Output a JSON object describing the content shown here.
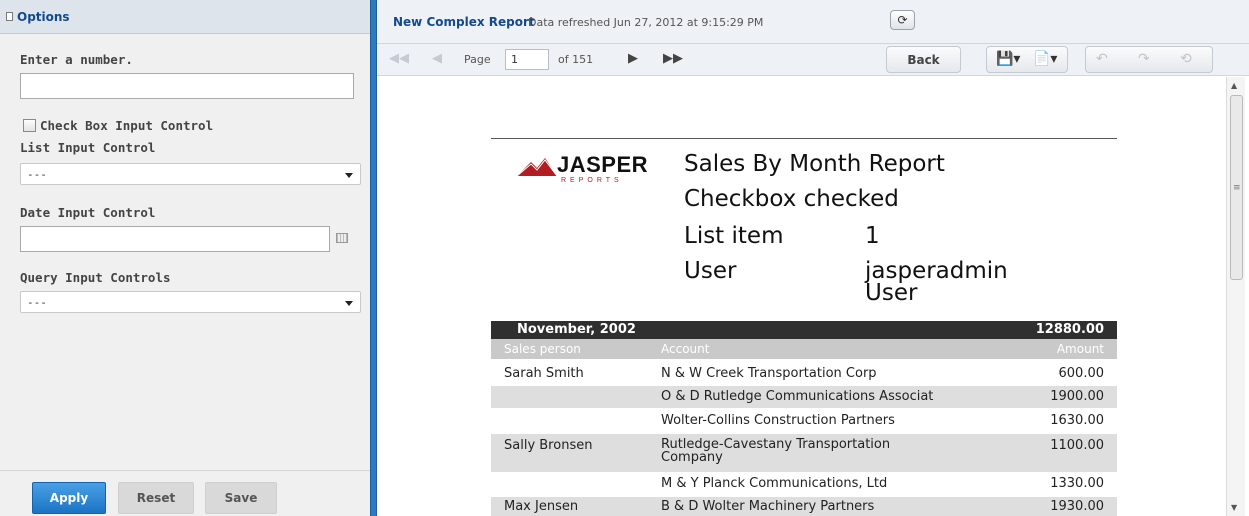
{
  "options": {
    "title": "Options",
    "number_label": "Enter a number.",
    "checkbox_label": "Check Box Input Control",
    "list_label": "List Input Control",
    "list_value": "---",
    "date_label": "Date Input Control",
    "query_label": "Query Input Controls",
    "query_value": "---",
    "apply": "Apply",
    "reset": "Reset",
    "save": "Save"
  },
  "viewer": {
    "report_title": "New Complex Report",
    "refreshed": "Data refreshed Jun 27, 2012 at 9:15:29 PM",
    "page_label": "Page",
    "page_value": "1",
    "of_label": "of 151",
    "back": "Back"
  },
  "report": {
    "logo": "JASPER",
    "logo_sub": "REPORTS",
    "title": "Sales By Month Report",
    "checkbox_status": "Checkbox checked",
    "list_item_label": "List item",
    "list_item_value": "1",
    "user_label": "User",
    "user_value_1": "jasperadmin",
    "user_value_2": "User",
    "month": "November, 2002",
    "month_total": "12880.00",
    "col_person": "Sales person",
    "col_account": "Account",
    "col_amount": "Amount",
    "rows": [
      {
        "person": "Sarah Smith",
        "account": "N & W Creek Transportation Corp",
        "amount": "600.00"
      },
      {
        "person": "",
        "account": "O & D Rutledge Communications Associat",
        "amount": "1900.00"
      },
      {
        "person": "",
        "account": "Wolter-Collins Construction Partners",
        "amount": "1630.00"
      },
      {
        "person": "Sally Bronsen",
        "account": "Rutledge-Cavestany Transportation",
        "account2": "Company",
        "amount": "1100.00"
      },
      {
        "person": "",
        "account": "M & Y Planck Communications, Ltd",
        "amount": "1330.00"
      },
      {
        "person": "Max Jensen",
        "account": "B & D Wolter Machinery Partners",
        "amount": "1930.00"
      }
    ]
  },
  "colors": {
    "accent": "#2e7ac0",
    "apply_button": "#1b73c4",
    "logo_red": "#b01e23"
  }
}
